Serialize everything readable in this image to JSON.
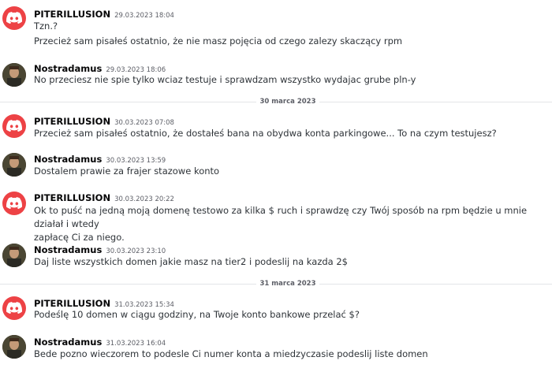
{
  "messages": [
    {
      "author": "PITERILLUSION",
      "timestamp": "29.03.2023 18:04",
      "lines": [
        "Tzn.?",
        "Przecież sam pisałeś ostatnio, że nie masz pojęcia od czego zalezy skaczący rpm"
      ]
    },
    {
      "author": "Nostradamus",
      "timestamp": "29.03.2023 18:06",
      "lines": [
        "No przeciesz nie spie tylko wciaz testuje i sprawdzam wszystko wydajac grube pln-y"
      ]
    },
    {
      "author": "PITERILLUSION",
      "timestamp": "30.03.2023 07:08",
      "lines": [
        "Przecież sam pisałeś ostatnio, że dostałeś bana na obydwa konta parkingowe... To na czym testujesz?"
      ]
    },
    {
      "author": "Nostradamus",
      "timestamp": "30.03.2023 13:59",
      "lines": [
        "Dostalem prawie za frajer stazowe konto"
      ]
    },
    {
      "author": "PITERILLUSION",
      "timestamp": "30.03.2023 20:22",
      "lines": [
        "Ok to puść na jedną moją domenę testowo za kilka $ ruch i sprawdzę czy Twój sposób na rpm będzie u mnie działał i wtedy",
        "zapłacę Ci za niego."
      ]
    },
    {
      "author": "Nostradamus",
      "timestamp": "30.03.2023 23:10",
      "lines": [
        "Daj liste wszystkich domen jakie masz na tier2 i podeslij na kazda 2$"
      ]
    },
    {
      "author": "PITERILLUSION",
      "timestamp": "31.03.2023 15:34",
      "lines": [
        "Podeślę 10 domen w ciągu godziny, na Twoje konto bankowe przelać $?"
      ]
    },
    {
      "author": "Nostradamus",
      "timestamp": "31.03.2023 16:04",
      "lines": [
        "Bede pozno wieczorem to podesle Ci numer konta a miedzyczasie podeslij liste domen"
      ]
    }
  ],
  "dividers": [
    "30 marca 2023",
    "31 marca 2023"
  ],
  "colors": {
    "discord_red": "#ed4245",
    "username": "#060607",
    "text": "#2e3338",
    "muted": "#5c5e66",
    "divider": "#e3e5e8"
  },
  "icons": {
    "discord_avatar": "discord-logo-icon",
    "user_avatar": "user-photo-avatar"
  }
}
